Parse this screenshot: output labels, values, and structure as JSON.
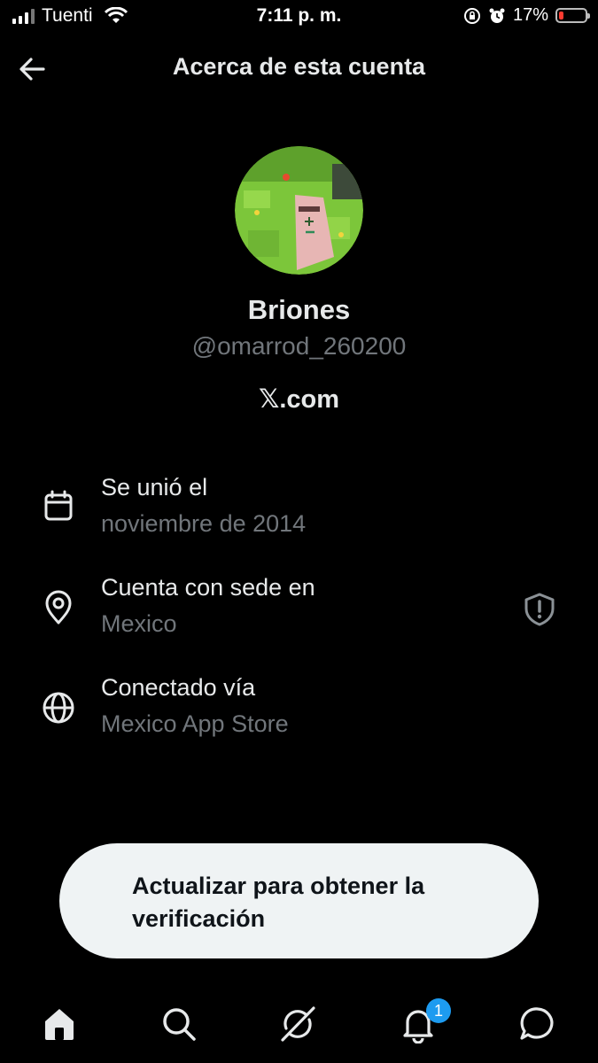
{
  "status_bar": {
    "carrier": "Tuenti",
    "time": "7:11 p. m.",
    "battery_percent": "17%",
    "battery_level": 0.17,
    "battery_color": "#ff3b30"
  },
  "header": {
    "title": "Acerca de esta cuenta",
    "back_icon": "arrow-left-icon"
  },
  "profile": {
    "display_name": "Briones",
    "handle": "@omarrod_260200",
    "site": "𝕏.com"
  },
  "details": [
    {
      "icon": "calendar-icon",
      "title": "Se unió el",
      "value": "noviembre de 2014"
    },
    {
      "icon": "location-pin-icon",
      "title": "Cuenta con sede en",
      "value": "Mexico",
      "extra_icon": "shield-alert-icon"
    },
    {
      "icon": "globe-icon",
      "title": "Conectado vía",
      "value": "Mexico App Store"
    }
  ],
  "upgrade": {
    "label": "Actualizar para obtener la verificación"
  },
  "tab_bar": {
    "items": [
      "home-icon",
      "search-icon",
      "grok-icon",
      "notifications-icon",
      "messages-icon"
    ],
    "notifications_badge": "1",
    "badge_color": "#1d9bf0"
  }
}
